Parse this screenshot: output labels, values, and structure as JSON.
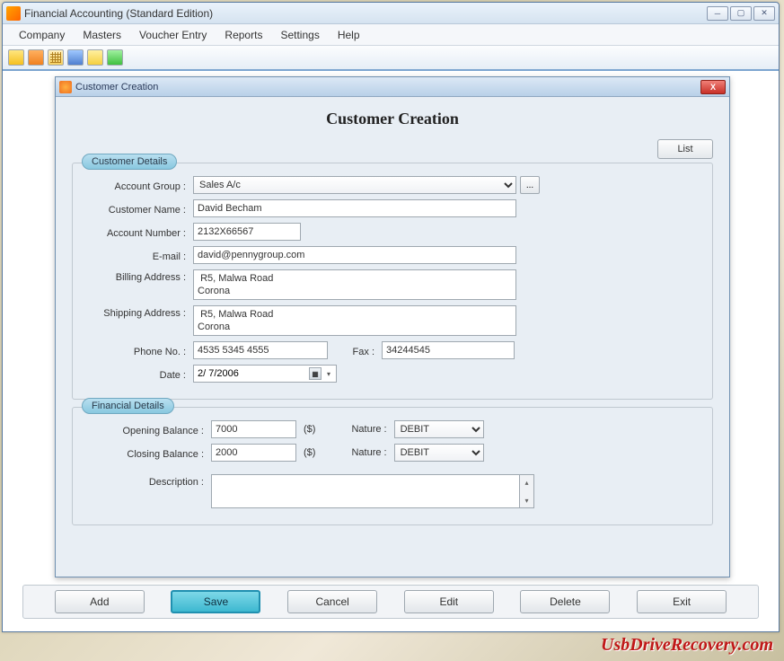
{
  "outer_window": {
    "title": "Financial Accounting (Standard Edition)"
  },
  "menubar": [
    "Company",
    "Masters",
    "Voucher Entry",
    "Reports",
    "Settings",
    "Help"
  ],
  "inner_window": {
    "title": "Customer Creation"
  },
  "heading": "Customer Creation",
  "buttons": {
    "list": "List",
    "add": "Add",
    "save": "Save",
    "cancel": "Cancel",
    "edit": "Edit",
    "delete": "Delete",
    "exit": "Exit",
    "ellipsis": "..."
  },
  "legends": {
    "customer": "Customer Details",
    "financial": "Financial Details"
  },
  "labels": {
    "account_group": "Account Group :",
    "customer_name": "Customer Name :",
    "account_number": "Account Number :",
    "email": "E-mail :",
    "billing_address": "Billing Address :",
    "shipping_address": "Shipping Address :",
    "phone": "Phone No. :",
    "fax": "Fax :",
    "date": "Date :",
    "opening_balance": "Opening Balance :",
    "closing_balance": "Closing Balance :",
    "nature": "Nature :",
    "description": "Description :",
    "currency": "($)"
  },
  "values": {
    "account_group": "Sales A/c",
    "customer_name": "David Becham",
    "account_number": "2132X66567",
    "email": "david@pennygroup.com",
    "billing_address": " R5, Malwa Road\nCorona",
    "shipping_address": " R5, Malwa Road\nCorona",
    "phone": "4535 5345 4555",
    "fax": "34244545",
    "date": " 2/  7/2006",
    "opening_balance": "7000",
    "closing_balance": "2000",
    "nature_opening": "DEBIT",
    "nature_closing": "DEBIT",
    "description": ""
  },
  "watermark": "UsbDriveRecovery.com"
}
